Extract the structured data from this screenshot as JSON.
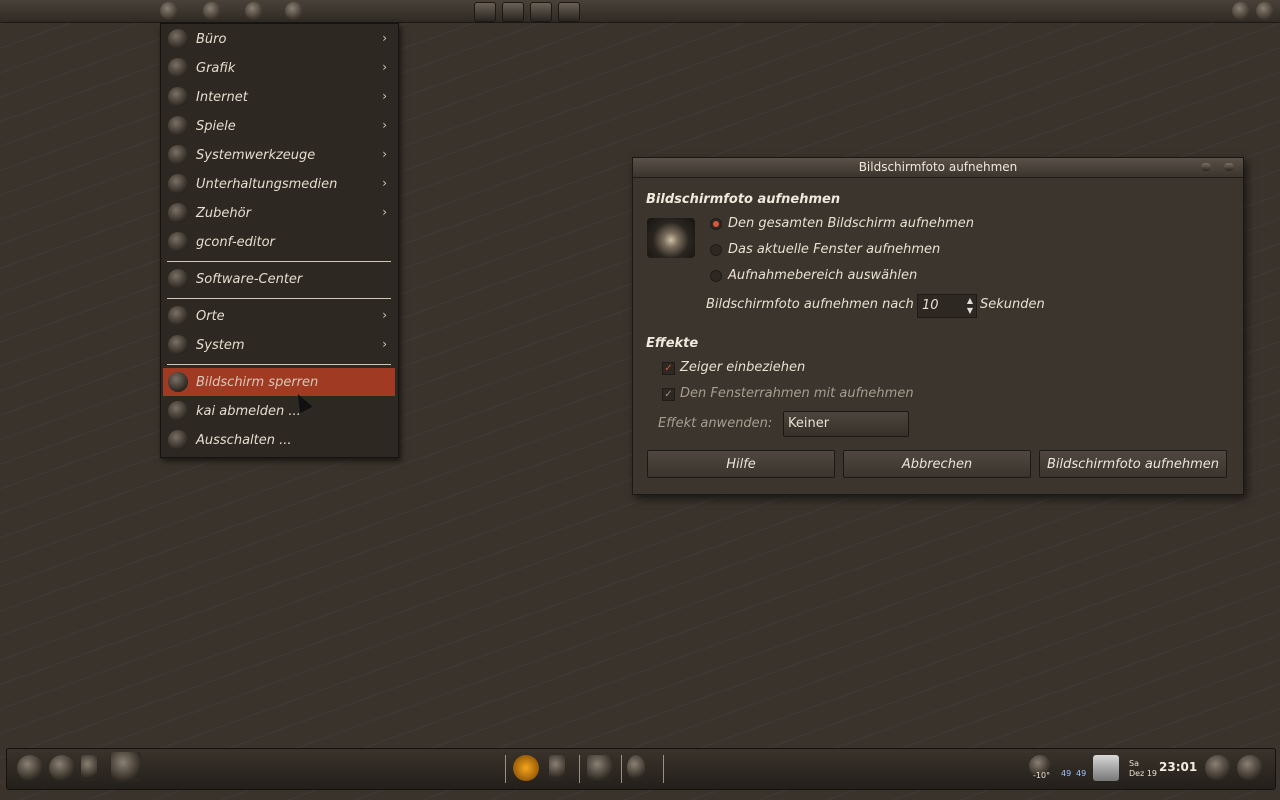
{
  "menu": {
    "items": [
      {
        "label": "Büro",
        "icon": "office-icon",
        "submenu": true
      },
      {
        "label": "Grafik",
        "icon": "graphics-icon",
        "submenu": true
      },
      {
        "label": "Internet",
        "icon": "internet-icon",
        "submenu": true
      },
      {
        "label": "Spiele",
        "icon": "games-icon",
        "submenu": true
      },
      {
        "label": "Systemwerkzeuge",
        "icon": "system-tools-icon",
        "submenu": true
      },
      {
        "label": "Unterhaltungsmedien",
        "icon": "multimedia-icon",
        "submenu": true
      },
      {
        "label": "Zubehör",
        "icon": "accessories-icon",
        "submenu": true
      },
      {
        "label": "gconf-editor",
        "icon": "gconf-icon",
        "submenu": false
      }
    ],
    "software_center": "Software-Center",
    "places": "Orte",
    "system": "System",
    "lock_screen": "Bildschirm sperren",
    "logout": "kai abmelden ...",
    "shutdown": "Ausschalten ...",
    "arrow": "›",
    "highlight_color": "#a03a22"
  },
  "dialog": {
    "title": "Bildschirmfoto aufnehmen",
    "section_heading": "Bildschirmfoto aufnehmen",
    "radio_whole": "Den gesamten Bildschirm aufnehmen",
    "radio_window": "Das aktuelle Fenster aufnehmen",
    "radio_area": "Aufnahmebereich auswählen",
    "selected_radio": "whole",
    "delay_label": "Bildschirmfoto aufnehmen nach",
    "delay_value": "10",
    "delay_unit": "Sekunden",
    "effects_heading": "Effekte",
    "include_pointer": "Zeiger einbeziehen",
    "include_pointer_checked": true,
    "include_border": "Den Fensterrahmen mit aufnehmen",
    "include_border_checked": true,
    "apply_effect_label": "Effekt anwenden:",
    "apply_effect_value": "Keiner",
    "help_button": "Hilfe",
    "cancel_button": "Abbrechen",
    "take_button": "Bildschirmfoto aufnehmen",
    "check_mark": "✓",
    "spin_up": "▲",
    "spin_down": "▼"
  },
  "bottom_panel": {
    "temperature": "-10°",
    "meter1": "49",
    "meter2": "49",
    "day": "Sa",
    "date": "Dez 19",
    "time": "23:01"
  }
}
